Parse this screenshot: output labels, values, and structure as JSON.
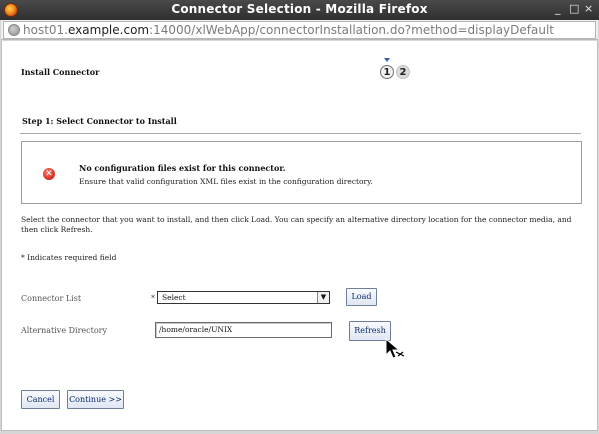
{
  "window": {
    "title": "Connector Selection - Mozilla Firefox",
    "minimize_glyph": "_",
    "maximize_glyph": "□",
    "close_glyph": "×"
  },
  "urlbar": {
    "prefix": "host01.",
    "host": "example.com",
    "rest": ":14000/xlWebApp/connectorInstallation.do?method=displayDefault"
  },
  "page": {
    "header_title": "Install Connector",
    "steps": [
      "1",
      "2"
    ],
    "step_title": "Step 1: Select Connector to Install",
    "message": {
      "title": "No configuration files exist for this connector.",
      "body": "Ensure that valid configuration XML files exist in the configuration directory.",
      "icon_glyph": "✕"
    },
    "instructions": "Select the connector that you want to install, and then click Load.  You can specify an alternative directory location for the connector media, and then click Refresh.",
    "required_note": "* Indicates required field",
    "connector_list": {
      "label": "Connector List",
      "required_mark": "*",
      "selected": "Select",
      "arrow_glyph": "▼"
    },
    "load_button": "Load",
    "alt_directory": {
      "label": "Alternative Directory",
      "value": "/home/oracle/UNIX"
    },
    "refresh_button": "Refresh",
    "cancel_button": "Cancel",
    "continue_button": "Continue >>"
  },
  "colors": {
    "titlebar": "#3a3a3a",
    "button_text": "#0b2b6b",
    "error_icon": "#d42a1c",
    "step_arrow": "#3a5fa6"
  }
}
